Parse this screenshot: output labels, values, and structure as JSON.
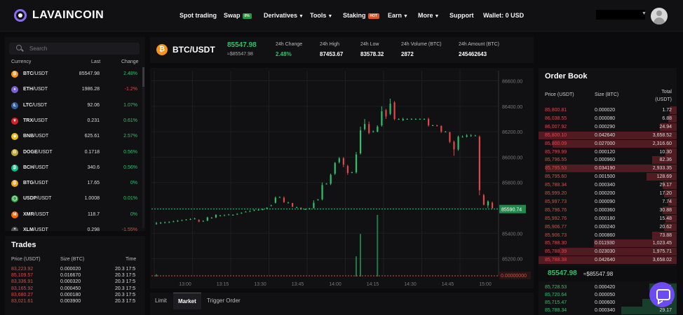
{
  "header": {
    "brand": "LAVAINCOIN",
    "nav": [
      {
        "label": "Spot trading",
        "caret": false
      },
      {
        "label": "Swap",
        "badge": "0%",
        "badge_color": "#1f9d45",
        "caret": false
      },
      {
        "label": "Derivatives",
        "caret": true
      },
      {
        "label": "Tools",
        "caret": true
      },
      {
        "label": "Staking",
        "badge": "HOT",
        "badge_color": "#e0542b",
        "caret": false
      },
      {
        "label": "Earn",
        "caret": true
      },
      {
        "label": "More",
        "caret": true
      },
      {
        "label": "Support",
        "caret": false
      },
      {
        "label": "Wallet: 0 USD",
        "caret": false
      }
    ]
  },
  "market": {
    "search_placeholder": "Search",
    "headers": {
      "currency": "Currency",
      "last": "Last",
      "change": "Change"
    },
    "rows": [
      {
        "base": "BTC",
        "quote": "/USDT",
        "last": "85547.98",
        "change": "2.48%",
        "up": true,
        "icon": "bitcoin-icon",
        "color": "#f7931a",
        "glyph": "₿"
      },
      {
        "base": "ETH",
        "quote": "/USDT",
        "last": "1986.28",
        "change": "-1.2%",
        "up": false,
        "icon": "ethereum-icon",
        "color": "#7b5fd6",
        "glyph": "♦"
      },
      {
        "base": "LTC",
        "quote": "/USDT",
        "last": "92.06",
        "change": "1.07%",
        "up": true,
        "icon": "litecoin-icon",
        "color": "#345d9d",
        "glyph": "Ł"
      },
      {
        "base": "TRX",
        "quote": "/USDT",
        "last": "0.231",
        "change": "0.61%",
        "up": true,
        "icon": "tron-icon",
        "color": "#d2232a",
        "glyph": "▼"
      },
      {
        "base": "BNB",
        "quote": "/USDT",
        "last": "625.61",
        "change": "2.57%",
        "up": true,
        "icon": "bnb-icon",
        "color": "#f0b90b",
        "glyph": "◆"
      },
      {
        "base": "DOGE",
        "quote": "/USDT",
        "last": "0.1718",
        "change": "0.56%",
        "up": true,
        "icon": "doge-icon",
        "color": "#c2a633",
        "glyph": "Ð"
      },
      {
        "base": "BCH",
        "quote": "/USDT",
        "last": "340.6",
        "change": "0.56%",
        "up": true,
        "icon": "bitcoin-cash-icon",
        "color": "#0ac18e",
        "glyph": "₿"
      },
      {
        "base": "BTG",
        "quote": "/USDT",
        "last": "17.65",
        "change": "0%",
        "up": true,
        "icon": "bitcoin-gold-icon",
        "color": "#eba809",
        "glyph": "₿"
      },
      {
        "base": "USDP",
        "quote": "/USDT",
        "last": "1.0008",
        "change": "0.01%",
        "up": true,
        "icon": "usdp-icon",
        "color": "#3aa84f",
        "glyph": "◯"
      },
      {
        "base": "XMR",
        "quote": "/USDT",
        "last": "118.7",
        "change": "0%",
        "up": true,
        "icon": "monero-icon",
        "color": "#ff6600",
        "glyph": "M"
      },
      {
        "base": "XLM",
        "quote": "/USDT",
        "last": "0.298",
        "change": "-1.55%",
        "up": false,
        "icon": "stellar-icon",
        "color": "#555",
        "glyph": "*"
      }
    ]
  },
  "trades": {
    "title": "Trades",
    "headers": {
      "price": "Price (USDT)",
      "size": "Size (BTC)",
      "time": "Time"
    },
    "rows": [
      {
        "price": "83,223.92",
        "size": "0.000020",
        "time": "20.3 17:5"
      },
      {
        "price": "85,109.57",
        "size": "0.016670",
        "time": "20.3 17:5"
      },
      {
        "price": "83,336.91",
        "size": "0.000320",
        "time": "20.3 17:5"
      },
      {
        "price": "83,165.92",
        "size": "0.000450",
        "time": "20.3 17:5"
      },
      {
        "price": "83,680.27",
        "size": "0.000180",
        "time": "20.3 17:5"
      },
      {
        "price": "83,021.61",
        "size": "0.003900",
        "time": "20.3 17:5"
      }
    ]
  },
  "ticker": {
    "pair": "BTC/USDT",
    "price": "85547.98",
    "approx": "≈$85547.98",
    "stats": [
      {
        "label": "24h Change",
        "value": "2.48%",
        "green": true
      },
      {
        "label": "24h High",
        "value": "87453.67",
        "green": false
      },
      {
        "label": "24h Low",
        "value": "83578.32",
        "green": false
      },
      {
        "label": "24h Volume (BTC)",
        "value": "2872",
        "green": false
      },
      {
        "label": "24h Amount (BTC)",
        "value": "245462643",
        "green": false
      }
    ]
  },
  "chart_data": {
    "type": "candlestick",
    "y_ticks": [
      "86600.00",
      "86400.00",
      "86200.00",
      "86000.00",
      "85800.00",
      "85600.00",
      "85400.00",
      "85200.00"
    ],
    "y_tick_values": [
      86600,
      86400,
      86200,
      86000,
      85800,
      85600,
      85400,
      85200
    ],
    "x_ticks": [
      "13:00",
      "13:15",
      "13:30",
      "13:45",
      "14:00",
      "14:15",
      "14:30",
      "14:45",
      "15:00"
    ],
    "current_price_label": "85590.74",
    "current_price": 85590.74,
    "volume_label": "0.00000000",
    "price_range": [
      85060,
      86680
    ],
    "candles": [
      [
        85478,
        85478,
        85490,
        85468
      ],
      [
        85482,
        85482,
        85490,
        85475
      ],
      [
        85486,
        85486,
        85492,
        85480
      ],
      [
        85488,
        85488,
        85495,
        85482
      ],
      [
        85494,
        85494,
        85500,
        85488
      ],
      [
        85498,
        85498,
        85505,
        85490
      ],
      [
        85503,
        85503,
        85508,
        85498
      ],
      [
        85508,
        85508,
        85512,
        85502
      ],
      [
        85512,
        85512,
        85518,
        85505
      ],
      [
        85516,
        85516,
        85522,
        85510
      ],
      [
        85505,
        85492,
        85510,
        85488
      ],
      [
        85497,
        85497,
        85502,
        85492
      ],
      [
        85500,
        85525,
        85530,
        85495
      ],
      [
        85522,
        85522,
        85528,
        85518
      ],
      [
        85525,
        85545,
        85550,
        85520
      ],
      [
        85540,
        85540,
        85545,
        85535
      ],
      [
        85542,
        85542,
        85548,
        85538
      ],
      [
        85548,
        85548,
        85552,
        85542
      ],
      [
        85545,
        85545,
        85550,
        85540
      ],
      [
        85552,
        85552,
        85558,
        85546
      ],
      [
        85560,
        85560,
        85566,
        85555
      ],
      [
        85570,
        85570,
        85575,
        85565
      ],
      [
        85575,
        85575,
        85580,
        85568
      ],
      [
        85582,
        85582,
        85588,
        85576
      ],
      [
        85585,
        85585,
        85590,
        85580
      ],
      [
        85588,
        85588,
        85594,
        85583
      ],
      [
        85600,
        85600,
        85605,
        85595
      ],
      [
        85620,
        85620,
        85625,
        85612
      ],
      [
        85640,
        85680,
        85690,
        85635
      ],
      [
        85685,
        85685,
        85690,
        85680
      ],
      [
        85680,
        85645,
        85690,
        85640
      ],
      [
        85642,
        85642,
        85648,
        85636
      ],
      [
        85638,
        85610,
        85640,
        85605
      ],
      [
        85605,
        85605,
        85610,
        85600
      ],
      [
        85600,
        85590,
        85605,
        85585
      ],
      [
        85590,
        85590,
        85595,
        85584
      ],
      [
        85595,
        85595,
        85600,
        85588
      ],
      [
        85600,
        85640,
        85660,
        85595
      ],
      [
        85665,
        85665,
        85670,
        85658
      ],
      [
        85668,
        85780,
        85800,
        85660
      ],
      [
        85790,
        85790,
        85795,
        85785
      ],
      [
        85790,
        85860,
        85870,
        85780
      ],
      [
        85870,
        85955,
        85960,
        85860
      ],
      [
        85960,
        85990,
        86000,
        85950
      ],
      [
        85990,
        85940,
        86000,
        85920
      ],
      [
        85930,
        85875,
        85940,
        85860
      ],
      [
        85880,
        85880,
        85885,
        85875
      ],
      [
        85880,
        86020,
        86040,
        85870
      ],
      [
        86030,
        86210,
        86240,
        86020
      ],
      [
        86220,
        86260,
        86300,
        86210
      ],
      [
        86260,
        86190,
        86280,
        86180
      ],
      [
        86200,
        86200,
        86210,
        86195
      ],
      [
        86200,
        86240,
        86250,
        86195
      ],
      [
        86250,
        86360,
        86400,
        86240
      ],
      [
        86370,
        86320,
        86380,
        86300
      ],
      [
        86340,
        86420,
        86460,
        86330
      ],
      [
        86430,
        86300,
        86440,
        86290
      ],
      [
        86300,
        86300,
        86305,
        86295
      ],
      [
        86290,
        86300,
        86310,
        86285
      ],
      [
        86300,
        86300,
        86305,
        86295
      ],
      [
        86300,
        86300,
        86305,
        86295
      ],
      [
        86300,
        86300,
        86305,
        86295
      ],
      [
        86300,
        86300,
        86305,
        86295
      ],
      [
        86300,
        86300,
        86305,
        86295
      ],
      [
        86300,
        86250,
        86310,
        86240
      ],
      [
        86250,
        86250,
        86255,
        86245
      ],
      [
        86250,
        86245,
        86255,
        86240
      ],
      [
        86245,
        86200,
        86250,
        86190
      ],
      [
        86200,
        86200,
        86205,
        86195
      ],
      [
        86195,
        86120,
        86200,
        86110
      ],
      [
        86120,
        86060,
        86130,
        86010
      ],
      [
        86060,
        86160,
        86170,
        86050
      ],
      [
        86160,
        86160,
        86170,
        86155
      ],
      [
        86160,
        86170,
        86180,
        86155
      ],
      [
        86170,
        86170,
        86180,
        86160
      ],
      [
        86170,
        86170,
        86175,
        86165
      ],
      [
        86160,
        85740,
        86170,
        85700
      ],
      [
        85700,
        85625,
        85710,
        85620
      ],
      [
        85620,
        85650,
        85660,
        85600
      ],
      [
        85640,
        85600,
        85650,
        85590
      ]
    ],
    "volumes": [
      2,
      0,
      0,
      0,
      0,
      0,
      0,
      0,
      0,
      0,
      0,
      0,
      0,
      0,
      0,
      0,
      0,
      0,
      0,
      0,
      0,
      0,
      0,
      0,
      0,
      0,
      0,
      0,
      0,
      0,
      0,
      0,
      0,
      0,
      0,
      0,
      0,
      0,
      0,
      0,
      0,
      0,
      0,
      0,
      0,
      0,
      0,
      18,
      38,
      0,
      0,
      0,
      55,
      0,
      0,
      0,
      0,
      0,
      0,
      0,
      0,
      0,
      0,
      0,
      0,
      0,
      0,
      0,
      0,
      0,
      0,
      0,
      0,
      0,
      0,
      0,
      0,
      0,
      0,
      0
    ]
  },
  "order_tabs": [
    "Limit",
    "Market",
    "Trigger Order"
  ],
  "order_book": {
    "title": "Order Book",
    "headers": {
      "price": "Price (USDT)",
      "size": "Size (BTC)",
      "total": "Total (USDT)"
    },
    "asks": [
      {
        "price": "85,800.81",
        "size": "0.000020",
        "total": "1.72",
        "depth": 0.05
      },
      {
        "price": "86,038.55",
        "size": "0.000080",
        "total": "6.88",
        "depth": 0.06
      },
      {
        "price": "86,007.92",
        "size": "0.000290",
        "total": "24.94",
        "depth": 0.12
      },
      {
        "price": "85,800.10",
        "size": "0.042640",
        "total": "3,658.52",
        "depth": 1.0
      },
      {
        "price": "85,800.09",
        "size": "0.027000",
        "total": "2,316.60",
        "depth": 0.9
      },
      {
        "price": "85,799.99",
        "size": "0.000120",
        "total": "10.30",
        "depth": 0.08
      },
      {
        "price": "85,796.55",
        "size": "0.000960",
        "total": "82.36",
        "depth": 0.18
      },
      {
        "price": "85,795.53",
        "size": "0.034190",
        "total": "2,933.35",
        "depth": 0.95
      },
      {
        "price": "85,795.60",
        "size": "0.001500",
        "total": "128.69",
        "depth": 0.22
      },
      {
        "price": "85,788.34",
        "size": "0.000340",
        "total": "29.17",
        "depth": 0.1
      },
      {
        "price": "85,999.20",
        "size": "0.000200",
        "total": "17.20",
        "depth": 0.09
      },
      {
        "price": "85,997.73",
        "size": "0.000090",
        "total": "7.74",
        "depth": 0.06
      },
      {
        "price": "85,796.76",
        "size": "0.000360",
        "total": "30.88",
        "depth": 0.1
      },
      {
        "price": "85,992.76",
        "size": "0.000180",
        "total": "15.48",
        "depth": 0.08
      },
      {
        "price": "85,906.77",
        "size": "0.000240",
        "total": "20.62",
        "depth": 0.09
      },
      {
        "price": "85,906.73",
        "size": "0.000860",
        "total": "73.88",
        "depth": 0.18
      },
      {
        "price": "85,788.30",
        "size": "0.011930",
        "total": "1,023.45",
        "depth": 0.6
      },
      {
        "price": "85,788.39",
        "size": "0.023030",
        "total": "1,975.71",
        "depth": 0.85
      },
      {
        "price": "85,788.38",
        "size": "0.042640",
        "total": "3,658.02",
        "depth": 1.0
      }
    ],
    "mid_price": "85547.98",
    "mid_approx": "≈$85547.98",
    "bids": [
      {
        "price": "85,728.53",
        "size": "0.000420",
        "total": "36.01",
        "depth": 0.2
      },
      {
        "price": "85,720.64",
        "size": "0.000050",
        "total": "4.29",
        "depth": 0.15
      },
      {
        "price": "85,715.47",
        "size": "0.000600",
        "total": "51.43",
        "depth": 0.25
      },
      {
        "price": "85,788.34",
        "size": "0.000340",
        "total": "29.17",
        "depth": 0.4
      }
    ]
  }
}
